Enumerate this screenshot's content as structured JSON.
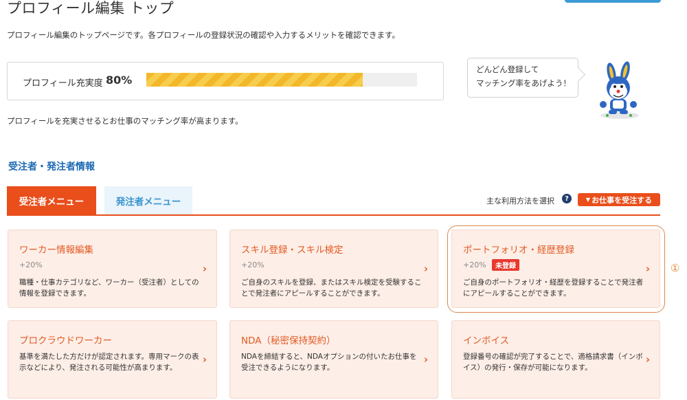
{
  "header": {
    "title": "プロフィール編集 トップ",
    "intro": "プロフィール編集のトップページです。各プロフィールの登録状況の確認や入力するメリットを確認できます。"
  },
  "completion": {
    "label": "プロフィール充実度",
    "percent_text": "80%",
    "percent": 80
  },
  "speech_bubble": {
    "line1": "どんどん登録して",
    "line2": "マッチング率をあげよう！"
  },
  "note": "プロフィールを充実させるとお仕事のマッチング率が高まります。",
  "section_title": "受注者・発注者情報",
  "tabs": [
    {
      "label": "受注者メニュー",
      "active": true
    },
    {
      "label": "発注者メニュー",
      "active": false
    }
  ],
  "usage": {
    "label": "主な利用方法を選択",
    "help_icon": "?",
    "button_label": "お仕事を受注する",
    "button_icon": "▼"
  },
  "cards": [
    {
      "title": "ワーカー情報編集",
      "sub": "+20%",
      "desc": "職種・仕事カテゴリなど、ワーカー（受注者）としての情報を登録できます。"
    },
    {
      "title": "スキル登録・スキル検定",
      "sub": "+20%",
      "desc": "ご自身のスキルを登録、またはスキル検定を受験することで発注者にアピールすることができます。"
    },
    {
      "title": "ポートフォリオ・経歴登録",
      "sub": "+20%",
      "badge": "未登録",
      "desc": "ご自身のポートフォリオ・経歴を登録することで発注者にアピールすることができます。"
    },
    {
      "title": "プロクラウドワーカー",
      "desc": "基準を満たした方だけが認定されます。専用マークの表示などにより、発注される可能性が高まります。"
    },
    {
      "title": "NDA（秘密保持契約）",
      "desc": "NDAを締結すると、NDAオプションの付いたお仕事を受注できるようになります。"
    },
    {
      "title": "インボイス",
      "desc": "登録番号の確認が完了することで、適格請求書（インボイス）の発行・保存が可能になります。"
    }
  ],
  "card_arrow": "›",
  "annotation": "①",
  "colors": {
    "accent": "#e94e1b",
    "link_blue": "#1e6ab3",
    "card_bg": "#fdeee7",
    "progress": "#f3b82a",
    "badge": "#e8382f"
  }
}
